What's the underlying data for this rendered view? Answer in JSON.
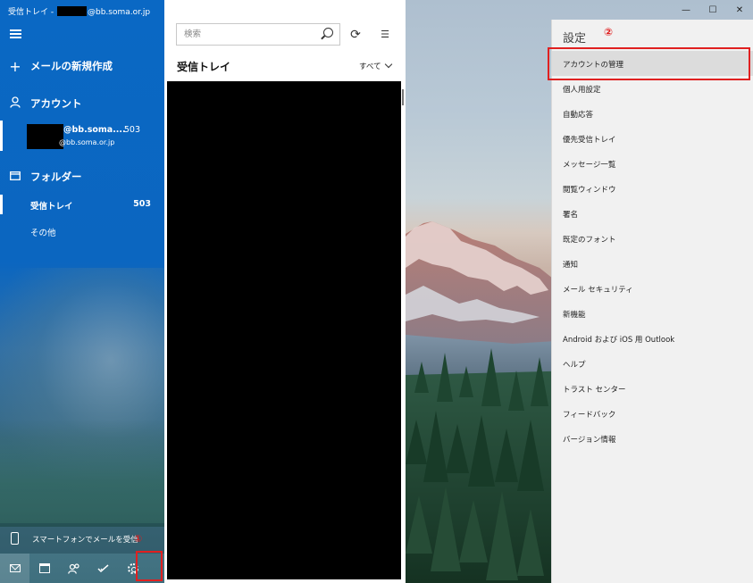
{
  "window": {
    "title_prefix": "受信トレイ - ",
    "title_suffix": "@bb.soma.or.jp",
    "controls": {
      "minimize": "—",
      "maximize": "☐",
      "close": "✕"
    }
  },
  "nav": {
    "new_mail": "メールの新規作成",
    "accounts_header": "アカウント",
    "account": {
      "name": "@bb.soma....",
      "domain": "@bb.soma.or.jp",
      "count": "503"
    },
    "folders_header": "フォルダー",
    "folders": [
      {
        "label": "受信トレイ",
        "count": "503"
      },
      {
        "label": "その他",
        "count": ""
      }
    ],
    "phone_promo": "スマートフォンでメールを受信",
    "bottom_buttons": [
      "mail-icon",
      "calendar-icon",
      "people-icon",
      "todo-icon",
      "gear-icon"
    ]
  },
  "list": {
    "search_placeholder": "検索",
    "title": "受信トレイ",
    "filter": "すべて"
  },
  "settings": {
    "title": "設定",
    "items": [
      "アカウントの管理",
      "個人用設定",
      "自動応答",
      "優先受信トレイ",
      "メッセージ一覧",
      "閲覧ウィンドウ",
      "署名",
      "既定のフォント",
      "通知",
      "メール セキュリティ",
      "新機能",
      "Android および iOS 用 Outlook",
      "ヘルプ",
      "トラスト センター",
      "フィードバック",
      "バージョン情報"
    ]
  },
  "annotations": {
    "one": "①",
    "two": "②"
  },
  "colors": {
    "accent": "#0b66c0",
    "annotation": "#e02020",
    "flyout_bg": "#f1f1f1"
  }
}
